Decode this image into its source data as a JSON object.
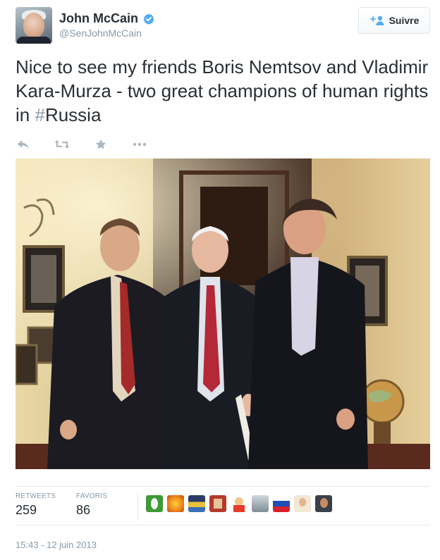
{
  "user": {
    "name": "John McCain",
    "handle": "@SenJohnMcCain",
    "verified": true
  },
  "follow_button": {
    "label": "Suivre",
    "icon": "add-user-icon"
  },
  "tweet": {
    "text_before": "Nice to see my friends Boris Nemtsov and Vladimir Kara-Murza - two great champions of human rights in ",
    "hashtag_symbol": "#",
    "hashtag": "Russia"
  },
  "actions": [
    {
      "name": "reply",
      "icon": "reply-icon"
    },
    {
      "name": "retweet",
      "icon": "retweet-icon"
    },
    {
      "name": "favorite",
      "icon": "star-icon"
    },
    {
      "name": "more",
      "icon": "more-icon"
    }
  ],
  "photo": {
    "icon": "photo-three-men"
  },
  "stats": {
    "retweets_label": "RETWEETS",
    "retweets_count": "259",
    "favorites_label": "FAVORIS",
    "favorites_count": "86"
  },
  "favoriters": [
    "avatar-1",
    "avatar-2",
    "avatar-3",
    "avatar-4",
    "avatar-5",
    "avatar-6",
    "avatar-7",
    "avatar-8",
    "avatar-9"
  ],
  "timestamp": "15:43 - 12 juin 2013",
  "colors": {
    "text": "#292f33",
    "muted": "#8899a6",
    "border": "#e1e8ed",
    "verified_blue": "#55acee"
  }
}
